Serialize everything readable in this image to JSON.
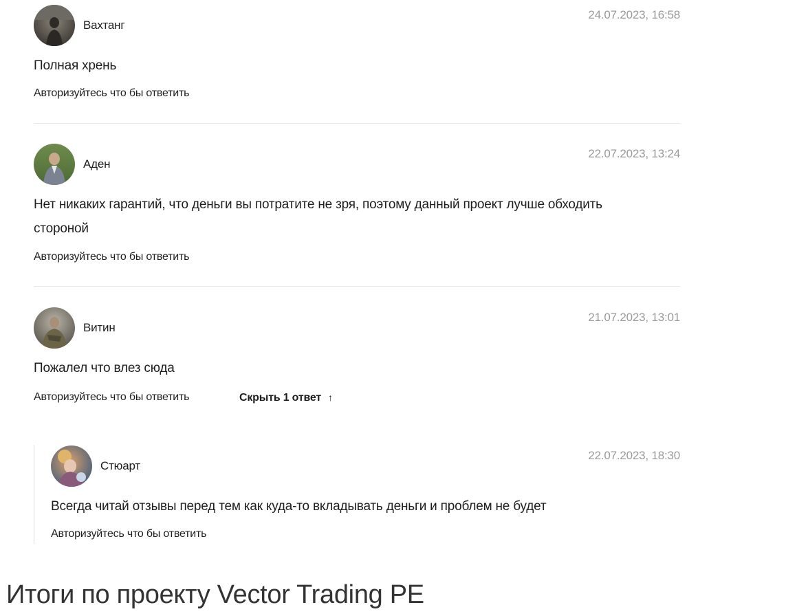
{
  "comments": [
    {
      "author": "Вахтанг",
      "date": "24.07.2023, 16:58",
      "text": "Полная хрень",
      "reply_label": "Авторизуйтесь что бы ответить"
    },
    {
      "author": "Аден",
      "date": "22.07.2023, 13:24",
      "text_lines": [
        "Нет никаких гарантий, что деньги вы потратите не зря, поэтому данный проект лучше обходить",
        "стороной"
      ],
      "reply_label": "Авторизуйтесь что бы ответить"
    },
    {
      "author": "Витин",
      "date": "21.07.2023, 13:01",
      "text": "Пожалел что влез сюда",
      "reply_label": "Авторизуйтесь что бы ответить",
      "toggle_replies_label": "Скрыть 1 ответ",
      "toggle_icon": "arrow-up-icon",
      "replies": [
        {
          "author": "Стюарт",
          "date": "22.07.2023, 18:30",
          "text": "Всегда читай отзывы перед тем как куда-то вкладывать деньги и проблем не будет",
          "reply_label": "Авторизуйтесь что бы ответить"
        }
      ]
    }
  ],
  "section_heading": "Итоги по проекту Vector Trading PE",
  "colors": {
    "text": "#1e1e1e",
    "date": "#9a9a9a",
    "divider": "#e8e8e8",
    "heading": "#333333"
  }
}
